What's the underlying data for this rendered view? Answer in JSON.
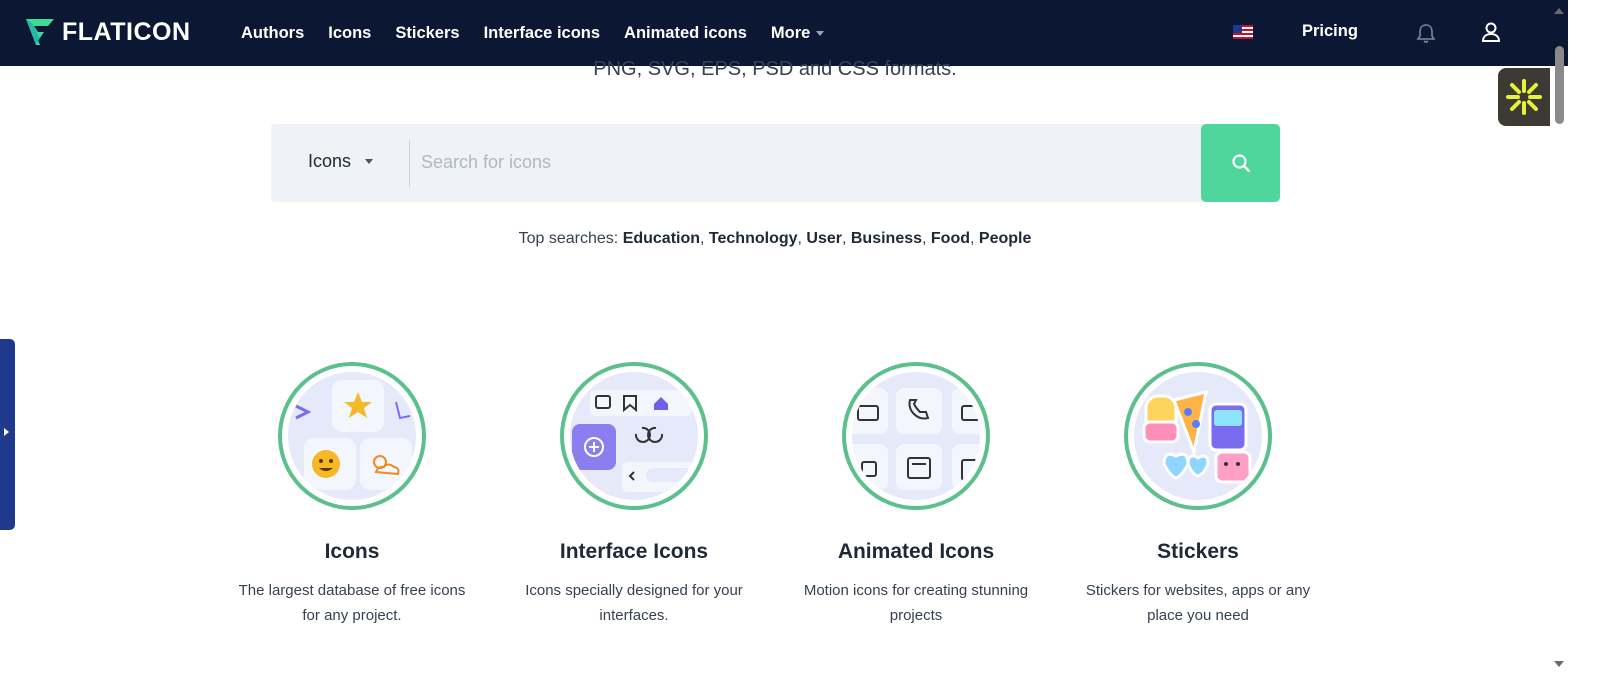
{
  "brand": {
    "name": "FLATICON"
  },
  "nav": {
    "items": [
      "Authors",
      "Icons",
      "Stickers",
      "Interface icons",
      "Animated icons",
      "More"
    ],
    "pricing": "Pricing"
  },
  "hero": {
    "subtitle": "PNG, SVG, EPS, PSD and CSS formats."
  },
  "search": {
    "type_label": "Icons",
    "placeholder": "Search for icons"
  },
  "top_searches": {
    "label": "Top searches:",
    "terms": [
      "Education",
      "Technology",
      "User",
      "Business",
      "Food",
      "People"
    ]
  },
  "categories": [
    {
      "title": "Icons",
      "desc_line1": "The largest database of free icons",
      "desc_line2": "for any project."
    },
    {
      "title": "Interface Icons",
      "desc_line1": "Icons specially designed for your",
      "desc_line2": "interfaces."
    },
    {
      "title": "Animated Icons",
      "desc_line1": "Motion icons for creating stunning",
      "desc_line2": "projects"
    },
    {
      "title": "Stickers",
      "desc_line1": "Stickers for websites, apps or any",
      "desc_line2": "place you need"
    }
  ],
  "colors": {
    "topbar": "#0b1733",
    "accent_green": "#4fd69c",
    "search_bg": "#eff2f6",
    "side_tab": "#1f3a8c"
  },
  "icons": [
    "flaticon-logo-icon",
    "us-flag-icon",
    "bell-icon",
    "user-icon",
    "search-icon",
    "extension-sparkle-icon"
  ]
}
